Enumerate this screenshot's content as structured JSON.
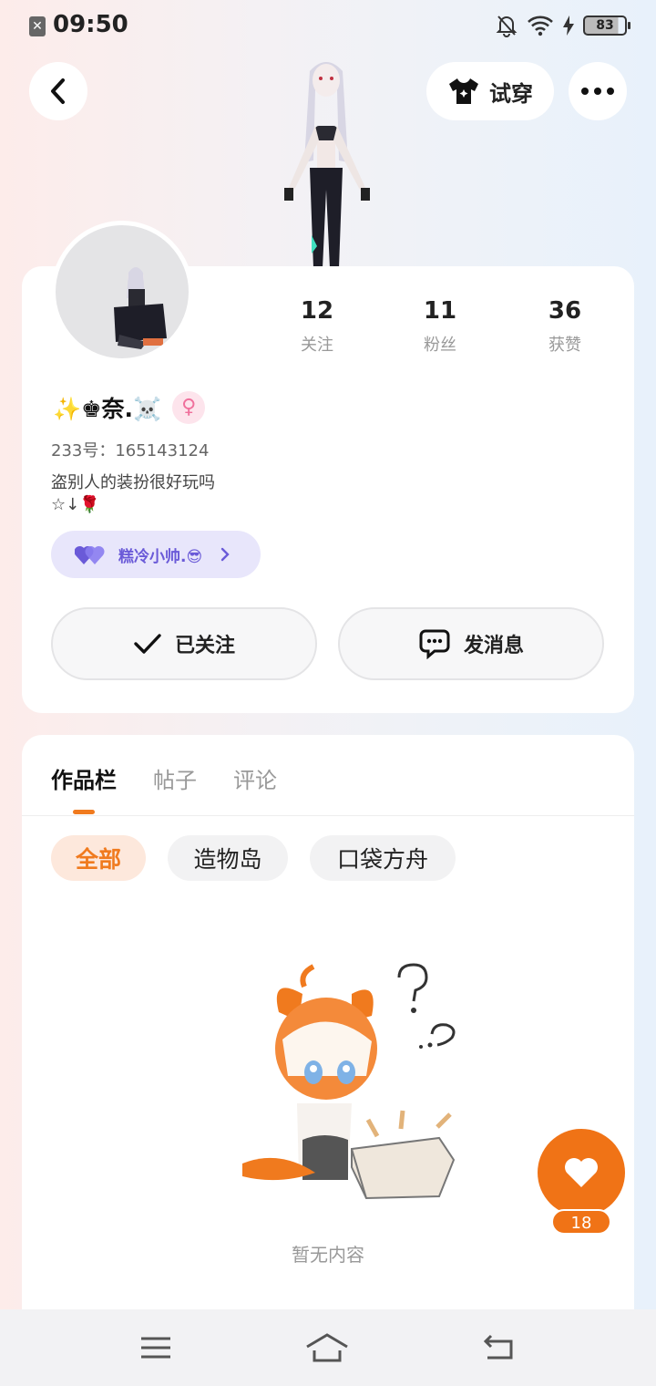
{
  "status_bar": {
    "time": "09:50",
    "battery": "83"
  },
  "header": {
    "try_on_label": "试穿"
  },
  "profile": {
    "name": "✨♚奈.☠️",
    "gender_symbol": "♀",
    "uid": "233号：165143124",
    "bio": "盗别人的装扮很好玩吗\n☆↓🌹",
    "bond_name": "糕冷小帅.😎"
  },
  "stats": [
    {
      "value": "12",
      "label": "关注"
    },
    {
      "value": "11",
      "label": "粉丝"
    },
    {
      "value": "36",
      "label": "获赞"
    }
  ],
  "actions": {
    "follow_label": "已关注",
    "message_label": "发消息"
  },
  "tabs": [
    "作品栏",
    "帖子",
    "评论"
  ],
  "filters": [
    "全部",
    "造物岛",
    "口袋方舟"
  ],
  "empty": {
    "text": "暂无内容"
  },
  "like": {
    "count": "18"
  },
  "colors": {
    "accent": "#f07316",
    "bond": "#6a5ad8"
  }
}
